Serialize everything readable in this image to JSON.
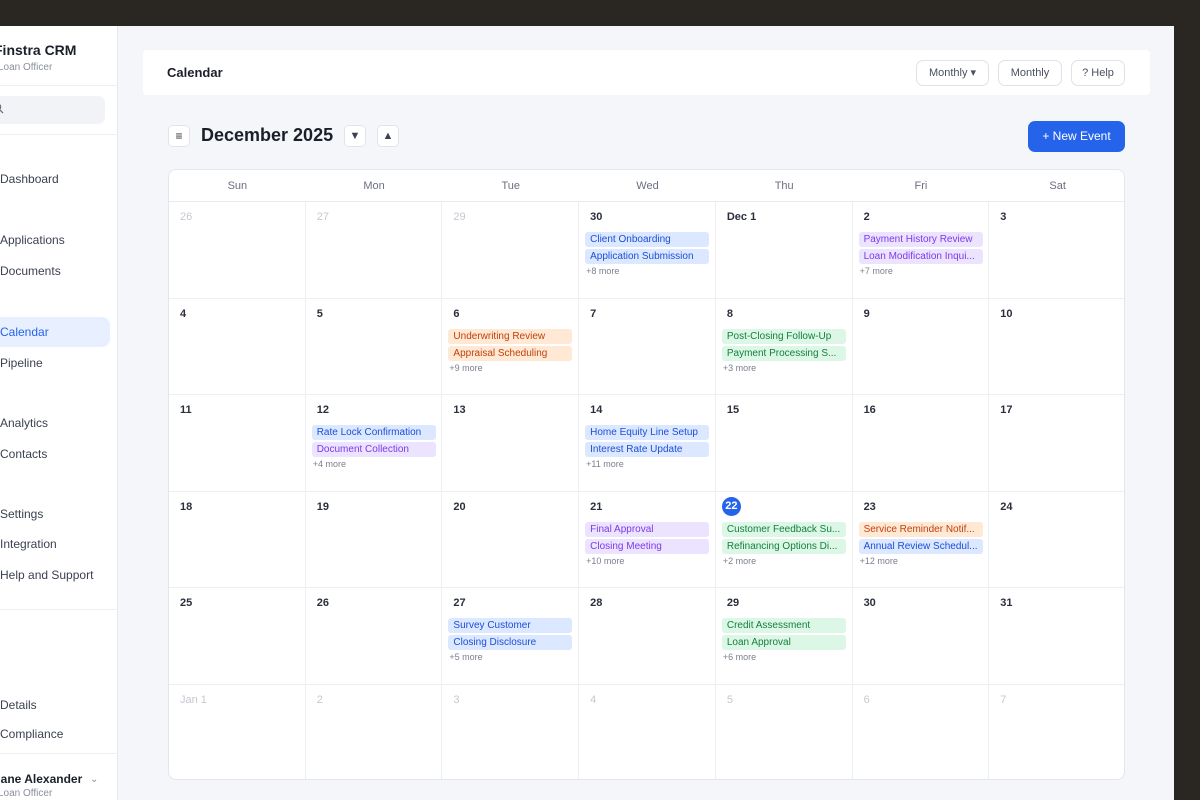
{
  "sidebar": {
    "brand": "Finstra CRM",
    "role": "Loan Officer",
    "search_icon": "search-icon",
    "items": [
      {
        "label": "Dashboard",
        "active": false
      },
      {
        "label": "Applications",
        "active": false
      },
      {
        "label": "Documents",
        "active": false
      },
      {
        "label": "Calendar",
        "active": true
      },
      {
        "label": "Pipeline",
        "active": false
      },
      {
        "label": "Analytics",
        "active": false
      },
      {
        "label": "Contacts",
        "active": false
      },
      {
        "label": "Settings",
        "active": false
      },
      {
        "label": "Integration",
        "active": false
      },
      {
        "label": "Help and Support",
        "active": false
      },
      {
        "label": "Details",
        "active": false
      },
      {
        "label": "Compliance",
        "active": false
      }
    ],
    "user_name": "Jane Alexander",
    "user_role": "Loan Officer"
  },
  "topbar": {
    "title": "Calendar",
    "view_dropdown": "Monthly ▾",
    "view_button": "Monthly",
    "help": "? Help"
  },
  "toolbar": {
    "menu_icon": "≡",
    "month": "December 2025",
    "prev": "▼",
    "next": "▲",
    "new_event": "+ New Event"
  },
  "weekdays": [
    "Sun",
    "Mon",
    "Tue",
    "Wed",
    "Thu",
    "Fri",
    "Sat"
  ],
  "colors": {
    "accent": "#2563eb",
    "blue_ev": "#dbe8ff",
    "purple_ev": "#ece3ff",
    "orange_ev": "#ffe8d4",
    "green_ev": "#dcf7e6"
  },
  "weeks": [
    [
      {
        "day": "26",
        "muted": true
      },
      {
        "day": "27",
        "muted": true
      },
      {
        "day": "29",
        "muted": true
      },
      {
        "day": "30",
        "events": [
          {
            "title": "Client Onboarding",
            "color": "blue"
          },
          {
            "title": "Application Submission",
            "color": "blue"
          }
        ],
        "more": "+8 more"
      },
      {
        "day": "Dec 1"
      },
      {
        "day": "2",
        "events": [
          {
            "title": "Payment History Review",
            "color": "purple"
          },
          {
            "title": "Loan Modification Inqui...",
            "color": "purple"
          }
        ],
        "more": "+7 more"
      },
      {
        "day": "3"
      }
    ],
    [
      {
        "day": "4"
      },
      {
        "day": "5"
      },
      {
        "day": "6",
        "events": [
          {
            "title": "Underwriting Review",
            "color": "orange"
          },
          {
            "title": "Appraisal Scheduling",
            "color": "orange"
          }
        ],
        "more": "+9 more"
      },
      {
        "day": "7"
      },
      {
        "day": "8",
        "events": [
          {
            "title": "Post-Closing Follow-Up",
            "color": "green"
          },
          {
            "title": "Payment Processing S...",
            "color": "green"
          }
        ],
        "more": "+3 more"
      },
      {
        "day": "9"
      },
      {
        "day": "10"
      }
    ],
    [
      {
        "day": "11"
      },
      {
        "day": "12",
        "events": [
          {
            "title": "Rate Lock Confirmation",
            "color": "blue"
          },
          {
            "title": "Document Collection",
            "color": "purple"
          }
        ],
        "more": "+4 more"
      },
      {
        "day": "13"
      },
      {
        "day": "14",
        "events": [
          {
            "title": "Home Equity Line Setup",
            "color": "blue"
          },
          {
            "title": "Interest Rate Update",
            "color": "blue"
          }
        ],
        "more": "+11 more"
      },
      {
        "day": "15"
      },
      {
        "day": "16"
      },
      {
        "day": "17"
      }
    ],
    [
      {
        "day": "18"
      },
      {
        "day": "19"
      },
      {
        "day": "20"
      },
      {
        "day": "21",
        "events": [
          {
            "title": "Final Approval",
            "color": "purple"
          },
          {
            "title": "Closing Meeting",
            "color": "purple"
          }
        ],
        "more": "+10 more"
      },
      {
        "day": "22",
        "today": true,
        "events": [
          {
            "title": "Customer Feedback Su...",
            "color": "green"
          },
          {
            "title": "Refinancing Options Di...",
            "color": "green"
          }
        ],
        "more": "+2 more"
      },
      {
        "day": "23",
        "events": [
          {
            "title": "Service Reminder Notif...",
            "color": "orange"
          },
          {
            "title": "Annual Review Schedul...",
            "color": "blue"
          }
        ],
        "more": "+12 more"
      },
      {
        "day": "24"
      }
    ],
    [
      {
        "day": "25"
      },
      {
        "day": "26"
      },
      {
        "day": "27",
        "events": [
          {
            "title": "Survey Customer",
            "color": "blue"
          },
          {
            "title": "Closing Disclosure",
            "color": "blue"
          }
        ],
        "more": "+5 more"
      },
      {
        "day": "28"
      },
      {
        "day": "29",
        "events": [
          {
            "title": "Credit Assessment",
            "color": "green"
          },
          {
            "title": "Loan Approval",
            "color": "green"
          }
        ],
        "more": "+6 more"
      },
      {
        "day": "30"
      },
      {
        "day": "31"
      }
    ],
    [
      {
        "day": "Jan 1",
        "muted": true
      },
      {
        "day": "2",
        "muted": true
      },
      {
        "day": "3",
        "muted": true
      },
      {
        "day": "4",
        "muted": true
      },
      {
        "day": "5",
        "muted": true
      },
      {
        "day": "6",
        "muted": true
      },
      {
        "day": "7",
        "muted": true
      }
    ]
  ]
}
